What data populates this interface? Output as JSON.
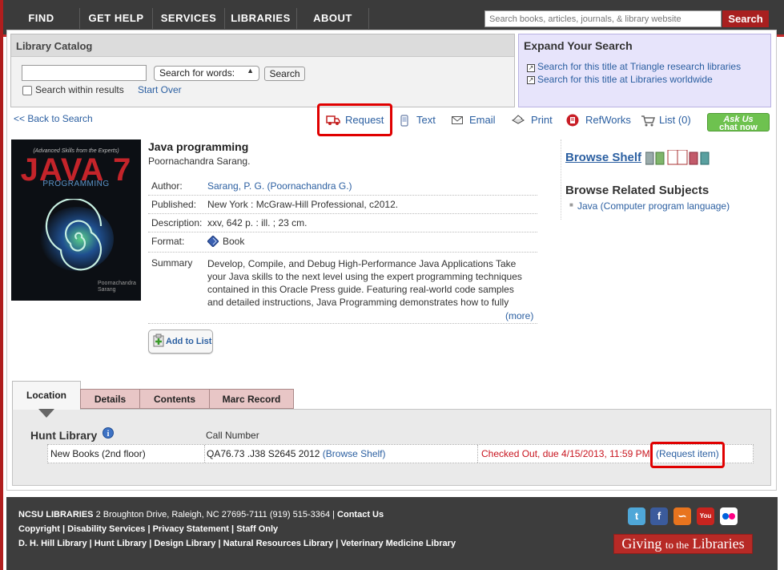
{
  "nav": {
    "items": [
      "FIND",
      "GET HELP",
      "SERVICES",
      "LIBRARIES",
      "ABOUT"
    ],
    "search_placeholder": "Search books, articles, journals, & library website",
    "search_button": "Search"
  },
  "catalog": {
    "title": "Library Catalog",
    "search_for": "Search for words:",
    "search_button": "Search",
    "within_results": "Search within results",
    "start_over": "Start Over"
  },
  "expand": {
    "title": "Expand Your Search",
    "links": [
      "Search for this title at Triangle research libraries",
      "Search for this title at Libraries worldwide"
    ]
  },
  "toolbar": {
    "back": "<< Back to Search",
    "request": "Request",
    "text": "Text",
    "email": "Email",
    "print": "Print",
    "refworks": "RefWorks",
    "list": "List (0)",
    "ask_us_1": "Ask Us",
    "ask_us_2": "chat now"
  },
  "cover": {
    "top": "(Advanced Skills from the Experts)",
    "title": "JAVA 7",
    "sub": "PROGRAMMING",
    "author1": "Poornachandra",
    "author2": "Sarang"
  },
  "record": {
    "title": "Java programming",
    "author_line": "Poornachandra Sarang.",
    "labels": {
      "author": "Author:",
      "published": "Published:",
      "description": "Description:",
      "format": "Format:",
      "summary": "Summary"
    },
    "author": "Sarang, P. G. (Poornachandra G.)",
    "published": "New York : McGraw-Hill Professional, c2012.",
    "description": "xxv, 642 p. : ill. ; 23 cm.",
    "format": "Book",
    "summary_lines": [
      "Develop, Compile, and Debug High-Performance Java Applications Take",
      "your Java skills to the next level using the expert programming techniques",
      "contained in this Oracle Press guide. Featuring real-world code samples",
      "and detailed instructions, Java Programming demonstrates how to fully"
    ],
    "more": "(more)",
    "add_to_list": "Add to List"
  },
  "side": {
    "browse_shelf": "Browse Shelf",
    "related_title": "Browse Related Subjects",
    "related_items": [
      "Java (Computer program language)"
    ]
  },
  "tabs": [
    "Location",
    "Details",
    "Contents",
    "Marc Record"
  ],
  "location": {
    "library": "Hunt Library",
    "call_number_header": "Call Number",
    "shelf": "New Books (2nd floor)",
    "call_number": "QA76.73 .J38 S2645 2012",
    "browse_shelf": "(Browse Shelf)",
    "status": "Checked Out, due 4/15/2013, 11:59 PM",
    "request_item": "(Request item)",
    "status_color": "#c8141e"
  },
  "footer": {
    "line1": [
      "NCSU LIBRARIES",
      " 2 Broughton Drive, Raleigh, NC 27695-7111 (919) 515-3364 | ",
      "Contact Us"
    ],
    "line2": [
      "Copyright",
      " | ",
      "Disability Services",
      " | ",
      "Privacy Statement",
      " | ",
      "Staff Only"
    ],
    "line3": [
      "D. H. Hill Library",
      " | ",
      "Hunt Library",
      " | ",
      "Design Library",
      " | ",
      "Natural Resources Library",
      " | ",
      "Veterinary Medicine Library"
    ],
    "social": [
      "twitter-icon",
      "facebook-icon",
      "rss-icon",
      "youtube-icon",
      "flickr-icon"
    ],
    "giving_1": "Giving",
    "giving_2": "to the",
    "giving_3": "Libraries"
  }
}
